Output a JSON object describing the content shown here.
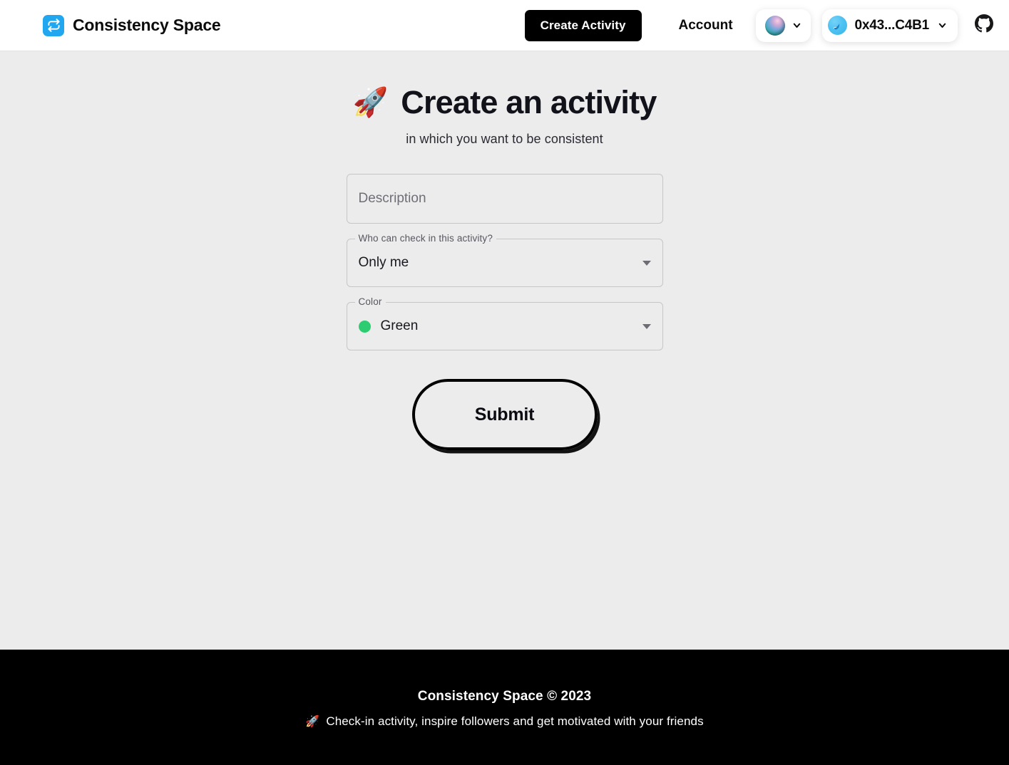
{
  "header": {
    "brand_name": "Consistency Space",
    "brand_logo_icon": "repeat-sync-icon",
    "create_activity_label": "Create Activity",
    "account_label": "Account",
    "network_selector": {
      "icon": "network-orb-icon",
      "chevron_icon": "chevron-down-icon"
    },
    "wallet": {
      "avatar_icon": "wallet-avatar-icon",
      "address": "0x43...C4B1",
      "chevron_icon": "chevron-down-icon"
    },
    "github_icon": "github-icon"
  },
  "main": {
    "title_emoji": "🚀",
    "title": "Create an activity",
    "subtitle": "in which you want to be consistent",
    "form": {
      "description": {
        "placeholder": "Description",
        "value": ""
      },
      "visibility": {
        "label": "Who can check in this activity?",
        "selected": "Only me"
      },
      "color": {
        "label": "Color",
        "selected": "Green",
        "selected_hex": "#2ecc71"
      },
      "submit_label": "Submit"
    }
  },
  "footer": {
    "title": "Consistency Space © 2023",
    "tagline_emoji": "🚀",
    "tagline": "Check-in activity, inspire followers and get motivated with your friends"
  },
  "theme": {
    "page_bg": "#ececec",
    "header_bg": "#ffffff",
    "footer_bg": "#000000",
    "brand_blue": "#21a6f0",
    "accent_black": "#000000"
  }
}
